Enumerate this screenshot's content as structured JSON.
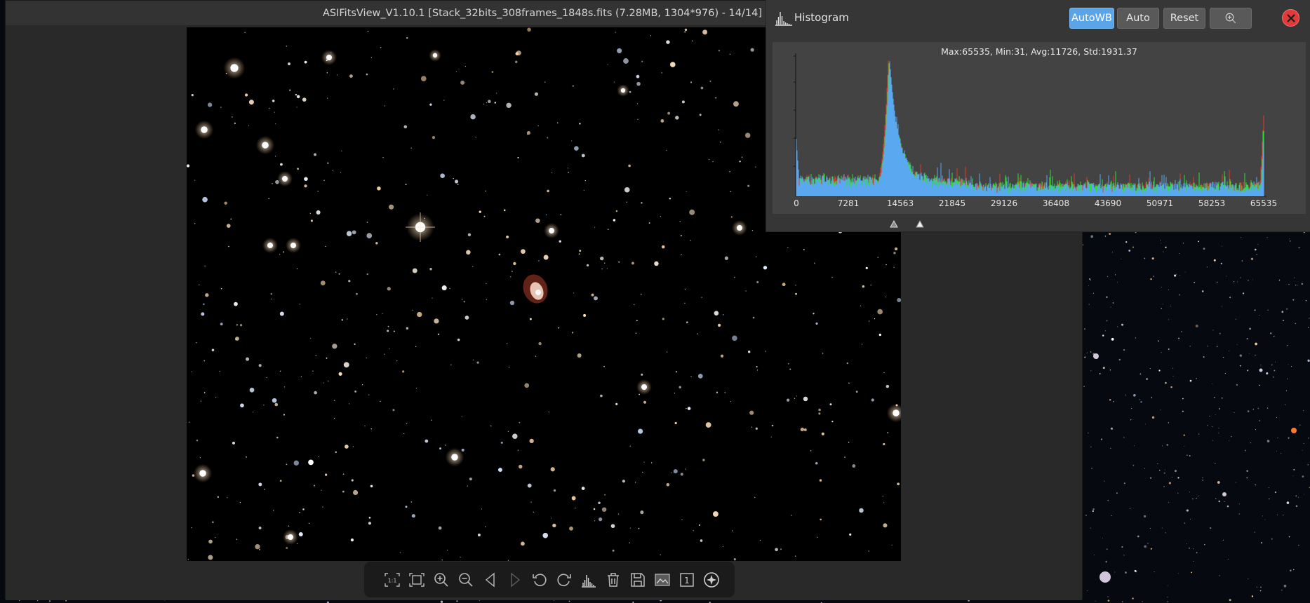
{
  "window": {
    "title": "ASIFitsView_V1.10.1 [Stack_32bits_308frames_1848s.fits (7.28MB, 1304*976) - 14/14]"
  },
  "toolbar": {
    "buttons": [
      {
        "name": "actual-size-button",
        "icon": "one-to-one-icon",
        "label": "1:1"
      },
      {
        "name": "fit-window-button",
        "icon": "fit-frame-icon"
      },
      {
        "name": "zoom-in-button",
        "icon": "zoom-in-icon"
      },
      {
        "name": "zoom-out-button",
        "icon": "zoom-out-icon"
      },
      {
        "name": "previous-image-button",
        "icon": "triangle-left-icon"
      },
      {
        "name": "next-image-button",
        "icon": "triangle-right-icon"
      },
      {
        "name": "rotate-left-button",
        "icon": "rotate-left-icon"
      },
      {
        "name": "rotate-right-button",
        "icon": "rotate-right-icon"
      },
      {
        "name": "histogram-button",
        "icon": "histogram-icon"
      },
      {
        "name": "delete-button",
        "icon": "trash-icon"
      },
      {
        "name": "save-button",
        "icon": "floppy-disk-icon"
      },
      {
        "name": "compare-button",
        "icon": "compare-icon"
      },
      {
        "name": "info-button",
        "icon": "frame-info-icon",
        "label": "1"
      },
      {
        "name": "star-detect-button",
        "icon": "star-circle-icon"
      }
    ]
  },
  "histogram": {
    "title": "Histogram",
    "buttons": {
      "autowb": "AutoWB",
      "auto": "Auto",
      "reset": "Reset"
    },
    "active_button": "AutoWB",
    "stats": "Max:65535, Min:31, Avg:11726, Std:1931.37",
    "x_ticks": [
      "0",
      "7281",
      "14563",
      "21845",
      "29126",
      "36408",
      "43690",
      "50971",
      "58253",
      "65535"
    ],
    "x_range": [
      0,
      65535
    ],
    "peak_value": 13000,
    "black_point": 13700,
    "white_point": 17300,
    "colors": {
      "red": "#e23a2a",
      "green": "#2ee12e",
      "blue": "#5aa8f0",
      "accent": "#5aa4ea",
      "close": "#e03a3a"
    }
  }
}
